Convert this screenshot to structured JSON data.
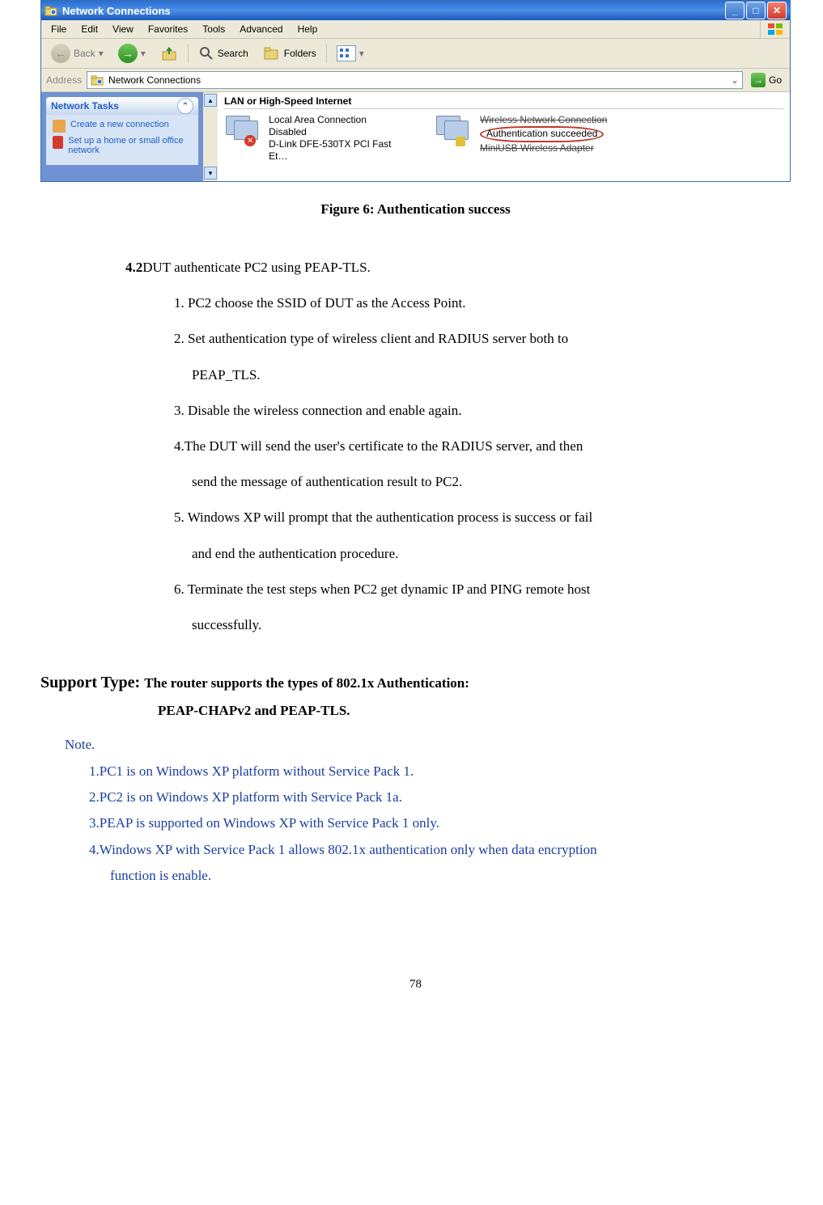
{
  "window": {
    "title": "Network Connections",
    "menu": [
      "File",
      "Edit",
      "View",
      "Favorites",
      "Tools",
      "Advanced",
      "Help"
    ],
    "toolbar": {
      "back": "Back",
      "search": "Search",
      "folders": "Folders"
    },
    "address": {
      "label": "Address",
      "value": "Network Connections",
      "go": "Go"
    },
    "tasks": {
      "header": "Network Tasks",
      "links": [
        "Create a new connection",
        "Set up a home or small office network"
      ]
    },
    "content": {
      "group_header": "LAN or High-Speed Internet",
      "lan": {
        "name": "Local Area Connection",
        "status": "Disabled",
        "device": "D-Link DFE-530TX PCI Fast Et…"
      },
      "wlan": {
        "name": "Wireless Network Connection",
        "status": "Authentication succeeded",
        "device": "MiniUSB Wireless Adapter"
      }
    }
  },
  "figure_caption": "Figure 6: Authentication success",
  "section": {
    "number": "4.2",
    "title": "DUT authenticate PC2 using PEAP-TLS.",
    "steps": {
      "s1": "1.  PC2 choose the SSID of DUT as the Access Point.",
      "s2": "2.  Set authentication type of wireless client and RADIUS server both to",
      "s2b": "PEAP_TLS.",
      "s3": "3.  Disable the wireless connection and enable again.",
      "s4": "4.The DUT will send the user's certificate to the RADIUS server, and then",
      "s4b": "send the message of authentication result to PC2.",
      "s5": "5.  Windows XP will prompt that the authentication process is success or fail",
      "s5b": "and end the authentication procedure.",
      "s6": "6.  Terminate the test steps when PC2 get dynamic IP and PING remote host",
      "s6b": "successfully."
    }
  },
  "support": {
    "label": "Support Type: ",
    "body_line1": "The router supports the types of    802.1x Authentication:",
    "body_line2": "PEAP-CHAPv2 and PEAP-TLS."
  },
  "notes": {
    "header": "Note.",
    "n1": "1.PC1 is on Windows XP platform without Service Pack 1.",
    "n2": "2.PC2 is on Windows XP platform with Service Pack 1a.",
    "n3": "3.PEAP is supported on Windows XP with Service Pack 1 only.",
    "n4": "4.Windows XP with Service Pack 1 allows 802.1x authentication only when data encryption",
    "n4b": "function is enable."
  },
  "page_number": "78"
}
